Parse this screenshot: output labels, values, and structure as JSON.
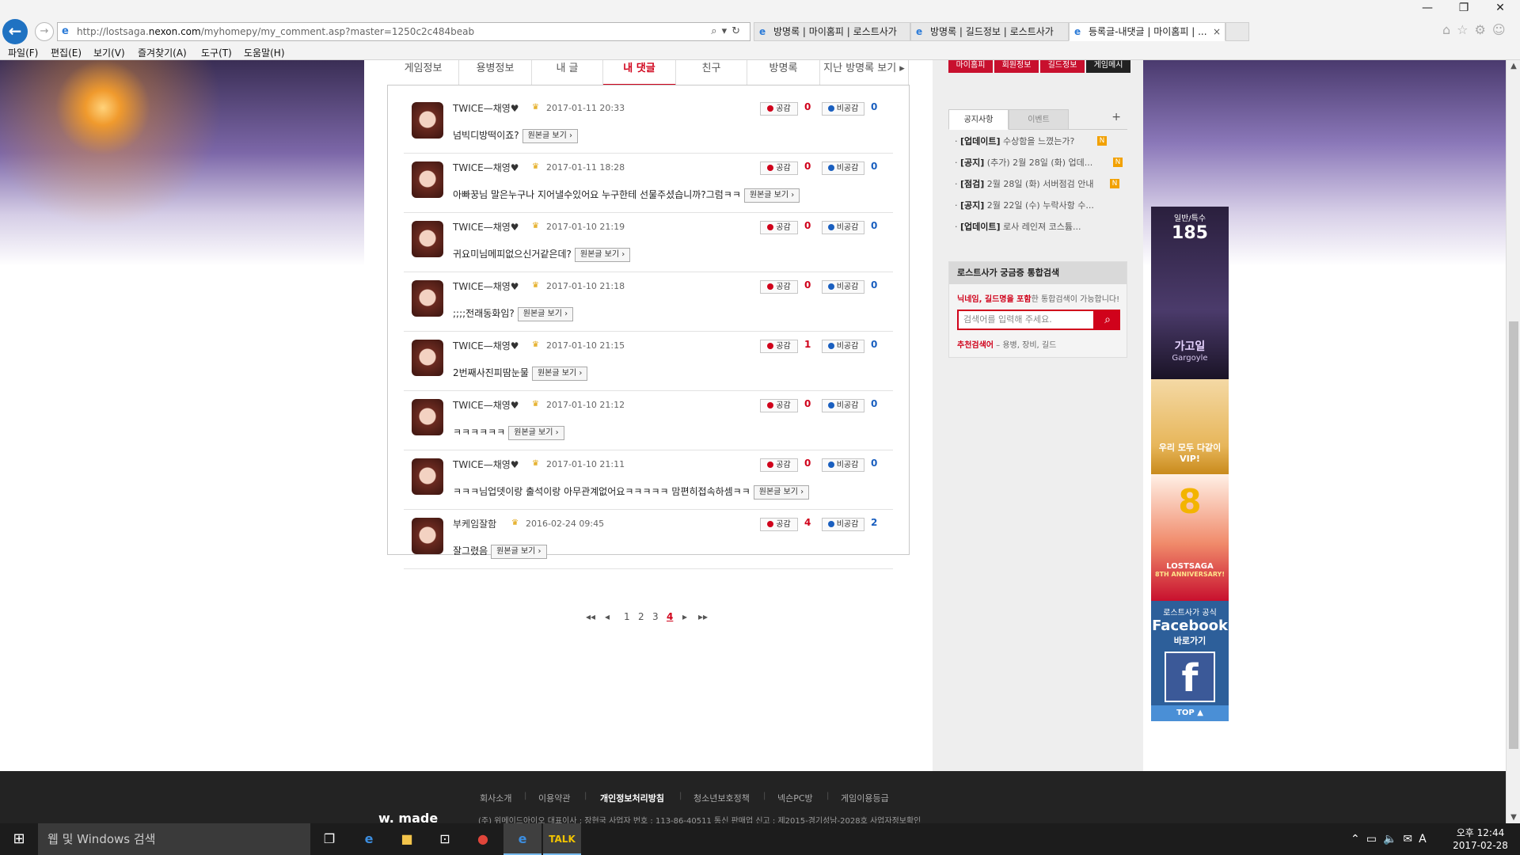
{
  "browser": {
    "url_prefix": "http://lostsaga.",
    "url_domain": "nexon.com",
    "url_path": "/myhomepy/my_comment.asp?master=1250c2c484beab",
    "tabs": [
      {
        "label": "방명록 | 마이홈피 | 로스트사가"
      },
      {
        "label": "방명록 | 길드정보 | 로스트사가"
      },
      {
        "label": "등록글-내댓글 | 마이홈피 | ...",
        "active": true
      }
    ],
    "menu": [
      "파일(F)",
      "편집(E)",
      "보기(V)",
      "즐겨찾기(A)",
      "도구(T)",
      "도움말(H)"
    ]
  },
  "tabs_nav": [
    {
      "label": "게임정보"
    },
    {
      "label": "용병정보"
    },
    {
      "label": "내 글"
    },
    {
      "label": "내 댓글",
      "active": true
    },
    {
      "label": "친구"
    },
    {
      "label": "방명록"
    },
    {
      "label": "지난 방명록 보기 ▸"
    }
  ],
  "comments": [
    {
      "nick": "TWICE—채영♥",
      "date": "2017-01-11 20:33",
      "body": "넘빅디방떡이죠?",
      "like_label": "공감",
      "like": "0",
      "dislike_label": "비공감",
      "dislike": "0",
      "button": "원본글 보기 ›"
    },
    {
      "nick": "TWICE—채영♥",
      "date": "2017-01-11 18:28",
      "body": "아빠꿍님 말은누구나 지어낼수있어요 누구한테 선물주셨습니까?그럼ㅋㅋ",
      "like_label": "공감",
      "like": "0",
      "dislike_label": "비공감",
      "dislike": "0",
      "button": "원본글 보기 ›"
    },
    {
      "nick": "TWICE—채영♥",
      "date": "2017-01-10 21:19",
      "body": "귀요미님메피없으신거같은데?",
      "like_label": "공감",
      "like": "0",
      "dislike_label": "비공감",
      "dislike": "0",
      "button": "원본글 보기 ›"
    },
    {
      "nick": "TWICE—채영♥",
      "date": "2017-01-10 21:18",
      "body": ";;;;전래동화임?",
      "like_label": "공감",
      "like": "0",
      "dislike_label": "비공감",
      "dislike": "0",
      "button": "원본글 보기 ›"
    },
    {
      "nick": "TWICE—채영♥",
      "date": "2017-01-10 21:15",
      "body": "2번째사진피땀눈물",
      "like_label": "공감",
      "like": "1",
      "dislike_label": "비공감",
      "dislike": "0",
      "button": "원본글 보기 ›"
    },
    {
      "nick": "TWICE—채영♥",
      "date": "2017-01-10 21:12",
      "body": "ㅋㅋㅋㅋㅋㅋ",
      "like_label": "공감",
      "like": "0",
      "dislike_label": "비공감",
      "dislike": "0",
      "button": "원본글 보기 ›"
    },
    {
      "nick": "TWICE—채영♥",
      "date": "2017-01-10 21:11",
      "body": "ㅋㅋㅋ님업뎃이랑 출석이랑 아무관계없어요ㅋㅋㅋㅋㅋ 맘편히접속하셈ㅋㅋ",
      "like_label": "공감",
      "like": "0",
      "dislike_label": "비공감",
      "dislike": "0",
      "button": "원본글 보기 ›"
    },
    {
      "nick": "부케임잘함",
      "date": "2016-02-24 09:45",
      "body": "잘그렸음",
      "like_label": "공감",
      "like": "4",
      "dislike_label": "비공감",
      "dislike": "2",
      "button": "원본글 보기 ›"
    }
  ],
  "pager": {
    "first": "◂◂",
    "prev": "◂",
    "pages": [
      "1",
      "2",
      "3",
      "4"
    ],
    "current": "4",
    "next": "▸",
    "last": "▸▸"
  },
  "sidebar": {
    "top_buttons": [
      "마이홈피",
      "회원정보",
      "길드정보",
      "게임메시"
    ],
    "notice_tabs": [
      {
        "label": "공지사항",
        "active": true
      },
      {
        "label": "이벤트"
      }
    ],
    "notice_plus": "+",
    "notices": [
      {
        "tag": "[업데이트]",
        "text": "수상함을 느꼈는가?",
        "badge": "N"
      },
      {
        "tag": "[공지]",
        "text": "(추가) 2월 28일 (화) 업데...",
        "badge": "N"
      },
      {
        "tag": "[점검]",
        "text": "2월 28일 (화) 서버점검 안내",
        "badge": "N"
      },
      {
        "tag": "[공지]",
        "text": "2월 22일 (수) 누락사항 수...",
        "badge": ""
      },
      {
        "tag": "[업데이트]",
        "text": "로사 레인져 코스튬...",
        "badge": ""
      }
    ],
    "search_title": "로스트사가 궁금증 통합검색",
    "search_note_highlight": "닉네임, 길드명을 포함",
    "search_note_rest": "한 통합검색이 가능합니다!",
    "search_placeholder": "검색어를 입력해 주세요.",
    "rec_label": "추천검색어",
    "rec_items": " – 용병, 장비, 길드"
  },
  "ads": {
    "ad1_top": "일반/특수",
    "ad1_num": "185",
    "ad1_name": "가고일",
    "ad1_sub": "Gargoyle",
    "ad2": "우리 모두 다같이 VIP!",
    "ad3_title": "LOSTSAGA",
    "ad3_sub": "8TH ANNIVERSARY!",
    "ad4_line1": "로스트사가 공식",
    "ad4_line2": "Facebook",
    "ad4_line3": "바로가기",
    "ad4_top": "TOP ▲"
  },
  "footer": {
    "links": [
      {
        "label": "회사소개"
      },
      {
        "label": "이용약관"
      },
      {
        "label": "개인정보처리방침",
        "strong": true
      },
      {
        "label": "청소년보호정책"
      },
      {
        "label": "넥슨PC방"
      },
      {
        "label": "게임이용등급"
      }
    ],
    "logo": "w. made",
    "info": "(주) 위메이드아이오   대표이사 : 장현국   사업자 번호 : 113-86-40511   통신 판매업 신고 : 제2015-경기성남-2028호   사업자정보확인"
  },
  "taskbar": {
    "search": "웹 및 Windows 검색",
    "time": "오후 12:44",
    "date": "2017-02-28",
    "ime": "A"
  }
}
